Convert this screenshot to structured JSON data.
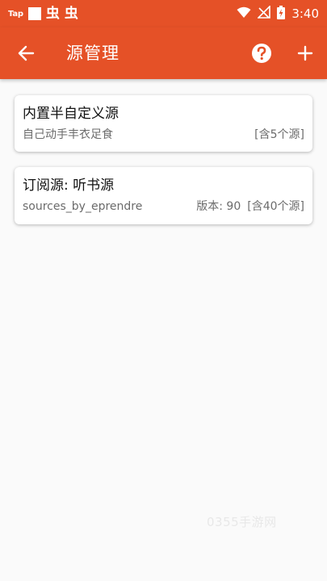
{
  "status_bar": {
    "carrier_label": "Tap",
    "bug_icon_1": "虫",
    "bug_icon_2": "虫",
    "time": "3:40"
  },
  "app_bar": {
    "title": "源管理",
    "icons": {
      "back": "back-arrow-icon",
      "help": "help-icon",
      "add": "add-icon"
    }
  },
  "sources": [
    {
      "name": "内置半自定义源",
      "subtitle": "自己动手丰衣足食",
      "version": "",
      "count": "[含5个源]"
    },
    {
      "name": "订阅源: 听书源",
      "subtitle": "sources_by_eprendre",
      "version": "版本: 90",
      "count": "[含40个源]"
    }
  ],
  "watermark": "0355手游网",
  "colors": {
    "primary": "#e55127",
    "background": "#fafafa",
    "card": "#ffffff"
  }
}
